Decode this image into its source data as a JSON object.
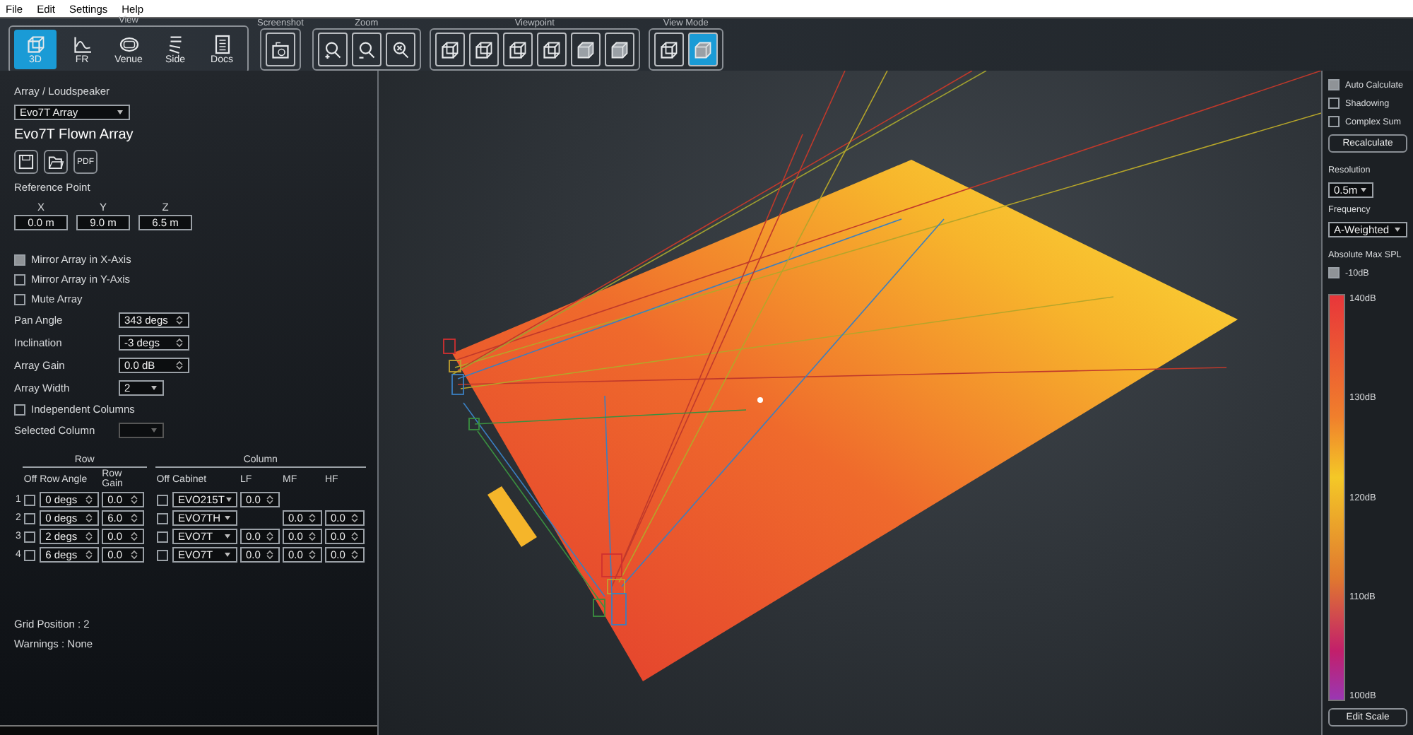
{
  "menu": [
    {
      "label": "File"
    },
    {
      "label": "Edit"
    },
    {
      "label": "Settings"
    },
    {
      "label": "Help"
    }
  ],
  "toolbar": [
    {
      "label": "View",
      "buttons": [
        {
          "kind": "cube",
          "label": "3D",
          "selected": true
        },
        {
          "kind": "graph",
          "label": "FR",
          "selected": false
        },
        {
          "kind": "venue",
          "label": "Venue",
          "selected": false
        },
        {
          "kind": "side",
          "label": "Side",
          "selected": false
        },
        {
          "kind": "docs",
          "label": "Docs",
          "selected": false
        }
      ]
    },
    {
      "label": "Screenshot",
      "buttons": [
        {
          "kind": "camera",
          "selected": false
        }
      ]
    },
    {
      "label": "Zoom",
      "buttons": [
        {
          "kind": "zoom-in",
          "selected": false
        },
        {
          "kind": "zoom-out",
          "selected": false
        },
        {
          "kind": "zoom-fit",
          "selected": false
        }
      ]
    },
    {
      "label": "Viewpoint",
      "buttons": [
        {
          "kind": "cube",
          "selected": false
        },
        {
          "kind": "cube",
          "selected": false
        },
        {
          "kind": "cube",
          "selected": false
        },
        {
          "kind": "cube",
          "selected": false
        },
        {
          "kind": "solid",
          "selected": false
        },
        {
          "kind": "solid",
          "selected": false
        }
      ]
    },
    {
      "label": "View Mode",
      "buttons": [
        {
          "kind": "cube",
          "selected": false
        },
        {
          "kind": "solid",
          "selected": true
        }
      ]
    }
  ],
  "left_panel": {
    "array_label": "Array / Loudspeaker",
    "array_select": "Evo7T Array",
    "array_name": "Evo7T Flown Array",
    "file_buttons": [
      {
        "kind": "save"
      },
      {
        "kind": "open"
      },
      {
        "kind": "pdf",
        "label": "PDF"
      }
    ],
    "reference_point": {
      "label": "Reference Point",
      "axes": [
        {
          "label": "X",
          "value": "0.0 m"
        },
        {
          "label": "Y",
          "value": "9.0 m"
        },
        {
          "label": "Z",
          "value": "6.5 m"
        }
      ]
    },
    "checks": [
      {
        "label": "Mirror Array in X-Axis",
        "checked": true
      },
      {
        "label": "Mirror Array in Y-Axis",
        "checked": false
      },
      {
        "label": "Mute Array",
        "checked": false
      }
    ],
    "params": [
      {
        "label": "Pan Angle",
        "value": "343 degs",
        "kind": "spin"
      },
      {
        "label": "Inclination",
        "value": "-3 degs",
        "kind": "spin"
      },
      {
        "label": "Array Gain",
        "value": "0.0 dB",
        "kind": "spin"
      },
      {
        "label": "Array Width",
        "value": "2",
        "kind": "dropdown"
      }
    ],
    "independent_columns": {
      "label": "Independent Columns",
      "checked": false
    },
    "selected_column": {
      "label": "Selected Column",
      "disabled": true
    },
    "table": {
      "groups": [
        "Row",
        "Column"
      ],
      "columns": [
        "Off",
        "Row Angle",
        "Row Gain",
        "Off",
        "Cabinet",
        "LF",
        "MF",
        "HF"
      ],
      "rows": [
        {
          "index": "1",
          "row_off": false,
          "row_angle": "0 degs",
          "row_gain": "0.0",
          "col_off": false,
          "cabinet": "EVO215T",
          "lf": "0.0"
        },
        {
          "index": "2",
          "row_off": false,
          "row_angle": "0 degs",
          "row_gain": "6.0",
          "col_off": false,
          "cabinet": "EVO7TH",
          "mf": "0.0",
          "hf": "0.0"
        },
        {
          "index": "3",
          "row_off": false,
          "row_angle": "2 degs",
          "row_gain": "0.0",
          "col_off": false,
          "cabinet": "EVO7T",
          "lf": "0.0",
          "mf": "0.0",
          "hf": "0.0"
        },
        {
          "index": "4",
          "row_off": false,
          "row_angle": "6 degs",
          "row_gain": "0.0",
          "col_off": false,
          "cabinet": "EVO7T",
          "lf": "0.0",
          "mf": "0.0",
          "hf": "0.0"
        }
      ]
    },
    "grid_position": "Grid Position : 2",
    "warnings": "Warnings : None"
  },
  "right_panel": {
    "checks": [
      {
        "label": "Auto Calculate",
        "checked": true
      },
      {
        "label": "Shadowing",
        "checked": false
      },
      {
        "label": "Complex Sum",
        "checked": false
      }
    ],
    "recalculate": "Recalculate",
    "resolution": {
      "label": "Resolution",
      "value": "0.5m"
    },
    "frequency": {
      "label": "Frequency",
      "value": "A-Weighted"
    },
    "scale_title": "Absolute Max SPL",
    "offset": {
      "label": "-10dB",
      "checked": true
    },
    "scale_labels": [
      "140dB",
      "130dB",
      "120dB",
      "110dB",
      "100dB"
    ],
    "edit_scale": "Edit Scale"
  }
}
